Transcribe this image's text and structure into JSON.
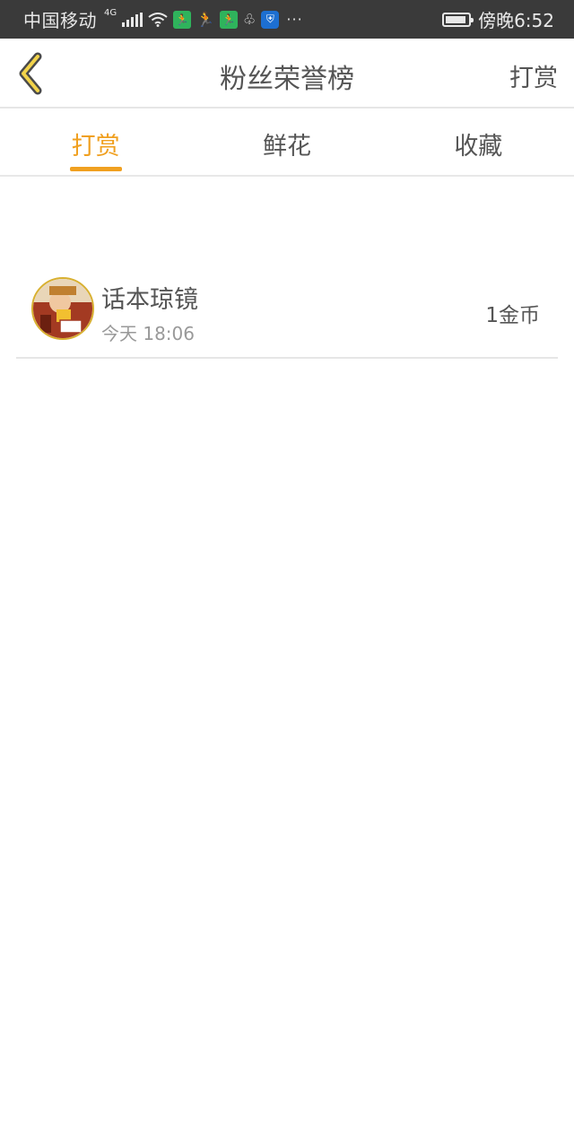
{
  "status_bar": {
    "carrier": "中国移动",
    "network": "4G",
    "time": "傍晚6:52",
    "dots": "···"
  },
  "header": {
    "title": "粉丝荣誉榜",
    "right_action": "打赏"
  },
  "tabs": [
    {
      "label": "打赏",
      "active": true
    },
    {
      "label": "鲜花",
      "active": false
    },
    {
      "label": "收藏",
      "active": false
    }
  ],
  "entries": [
    {
      "name": "话本琼镜",
      "time": "今天 18:06",
      "amount": "1金币"
    }
  ],
  "colors": {
    "accent": "#f0a020",
    "status_bar_bg": "#3a3a3a",
    "text_primary": "#555555",
    "text_secondary": "#999999",
    "divider": "#e6e6e6"
  },
  "icons": {
    "back": "chevron-left-icon",
    "avatar": "user-avatar"
  }
}
